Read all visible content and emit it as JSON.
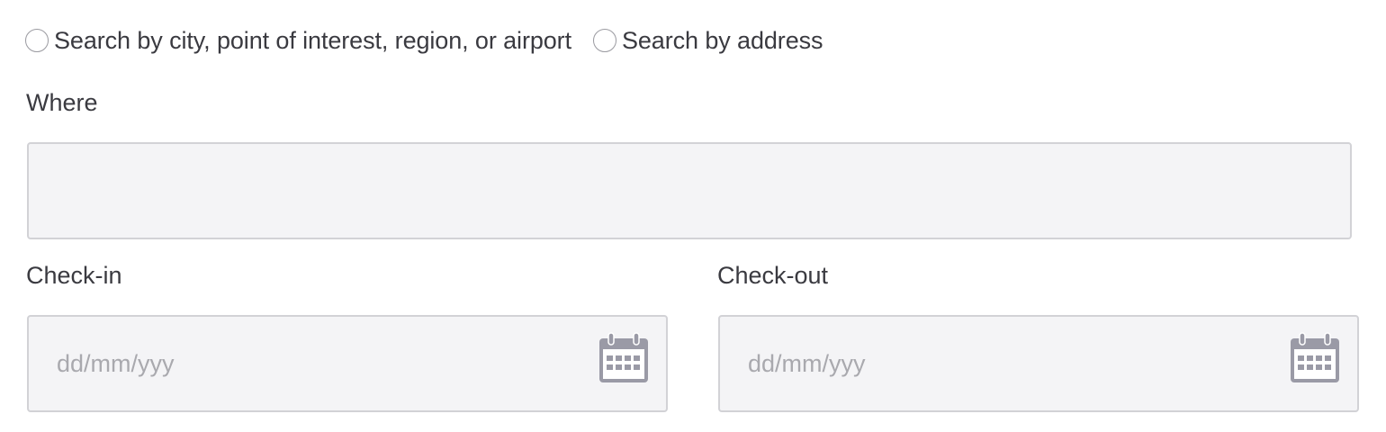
{
  "search_mode": {
    "options": [
      {
        "label": "Search by city, point of interest, region, or airport",
        "selected": false
      },
      {
        "label": "Search by address",
        "selected": false
      }
    ]
  },
  "where": {
    "label": "Where",
    "value": ""
  },
  "checkin": {
    "label": "Check-in",
    "placeholder": "dd/mm/yyy",
    "icon": "calendar-icon"
  },
  "checkout": {
    "label": "Check-out",
    "placeholder": "dd/mm/yyy",
    "icon": "calendar-icon"
  },
  "colors": {
    "field_background": "#f4f4f6",
    "field_border": "#d2d2d6",
    "icon": "#9a9aa6",
    "text": "#3a3a40",
    "placeholder": "#a9a9ae"
  }
}
